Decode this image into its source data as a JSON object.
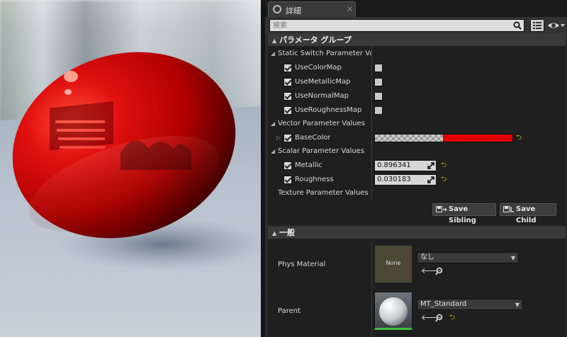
{
  "tab": {
    "label": "詳細",
    "close": "×"
  },
  "search": {
    "placeholder": "検索"
  },
  "param_group": {
    "title": "パラメータ グループ",
    "static_switch": {
      "label": "Static Switch Parameter Values",
      "items": [
        {
          "label": "UseColorMap",
          "enabled": true,
          "value": false
        },
        {
          "label": "UseMetallicMap",
          "enabled": true,
          "value": false
        },
        {
          "label": "UseNormalMap",
          "enabled": true,
          "value": false
        },
        {
          "label": "UseRoughnessMap",
          "enabled": true,
          "value": false
        }
      ]
    },
    "vector": {
      "label": "Vector Parameter Values",
      "items": [
        {
          "label": "BaseColor",
          "color": "#e00000"
        }
      ]
    },
    "scalar": {
      "label": "Scalar Parameter Values",
      "items": [
        {
          "label": "Metallic",
          "value": "0.896341"
        },
        {
          "label": "Roughness",
          "value": "0.030183"
        }
      ]
    },
    "texture": {
      "label": "Texture Parameter Values"
    },
    "save_sibling": "Save Sibling",
    "save_child": "Save Child"
  },
  "general": {
    "title": "一般",
    "phys_material": {
      "label": "Phys Material",
      "thumb_text": "None",
      "value": "なし"
    },
    "parent": {
      "label": "Parent",
      "value": "MT_Standard"
    }
  },
  "colors": {
    "accent_reset": "#e6b420",
    "base_color": "#e00000",
    "sphere_red": "#d40000"
  }
}
